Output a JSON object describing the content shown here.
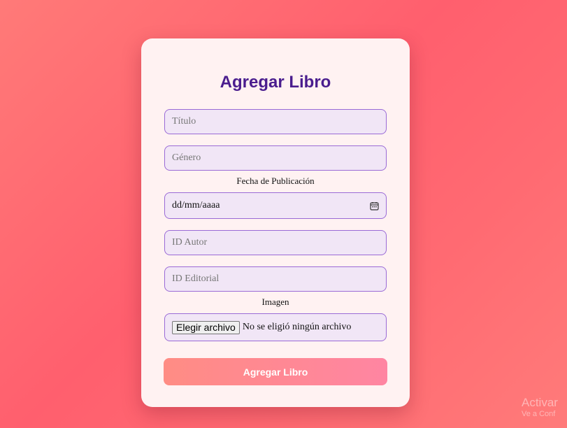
{
  "form": {
    "title": "Agregar Libro",
    "titulo_placeholder": "Título",
    "genero_placeholder": "Género",
    "fecha_label": "Fecha de Publicación",
    "fecha_value": "dd/mm/aaaa",
    "autor_placeholder": "ID Autor",
    "editorial_placeholder": "ID Editorial",
    "imagen_label": "Imagen",
    "file_button_label": "Elegir archivo",
    "file_status": "No se eligió ningún archivo",
    "submit_label": "Agregar Libro"
  },
  "watermark": {
    "line1": "Activar",
    "line2": "Ve a Conf"
  },
  "colors": {
    "title": "#4a1d8e",
    "field_bg": "#f1e6f6",
    "field_border": "#9a6ad6",
    "card_bg": "#fff2f2"
  }
}
